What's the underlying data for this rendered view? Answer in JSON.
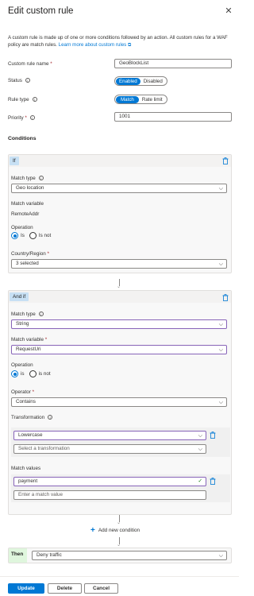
{
  "panel": {
    "title": "Edit custom rule",
    "description": "A custom rule is made up of one or more conditions followed by an action. All custom rules for a WAF policy are match rules.",
    "learn_more": "Learn more about custom rules"
  },
  "form": {
    "rule_name_label": "Custom rule name",
    "rule_name_value": "GeoBlockList",
    "status_label": "Status",
    "status_options": [
      "Enabled",
      "Disabled"
    ],
    "status_selected": "Enabled",
    "rule_type_label": "Rule type",
    "rule_type_options": [
      "Match",
      "Rate limit"
    ],
    "rule_type_selected": "Match",
    "priority_label": "Priority",
    "priority_value": "1001"
  },
  "conditions": {
    "heading": "Conditions",
    "first": {
      "tag": "If",
      "match_type_label": "Match type",
      "match_type_value": "Geo location",
      "match_variable_label": "Match variable",
      "match_variable_value": "RemoteAddr",
      "operation_label": "Operation",
      "operation_options": [
        "Is",
        "Is not"
      ],
      "operation_selected": "Is",
      "country_label": "Country/Region",
      "country_value": "3 selected"
    },
    "second": {
      "tag": "And if",
      "match_type_label": "Match type",
      "match_type_value": "String",
      "match_variable_label": "Match variable",
      "match_variable_value": "RequestUri",
      "operation_label": "Operation",
      "operation_options": [
        "is",
        "is not"
      ],
      "operation_selected": "is",
      "operator_label": "Operator",
      "operator_value": "Contains",
      "transformation_label": "Transformation",
      "transformation_value": "Lowercase",
      "transformation_placeholder": "Select a transformation",
      "match_values_label": "Match values",
      "match_value": "payment",
      "match_value_placeholder": "Enter a match value"
    },
    "add_condition": "Add new condition"
  },
  "then": {
    "tag": "Then",
    "action_value": "Deny traffic"
  },
  "footer": {
    "update": "Update",
    "delete": "Delete",
    "cancel": "Cancel"
  },
  "colors": {
    "accent": "#0078d4",
    "highlight_border": "#8764b8",
    "tag_bg": "#c7e0f4"
  },
  "icons": [
    "close-icon",
    "info-icon",
    "trash-icon",
    "chevron-down-icon",
    "plus-icon",
    "check-icon",
    "external-link-icon"
  ]
}
